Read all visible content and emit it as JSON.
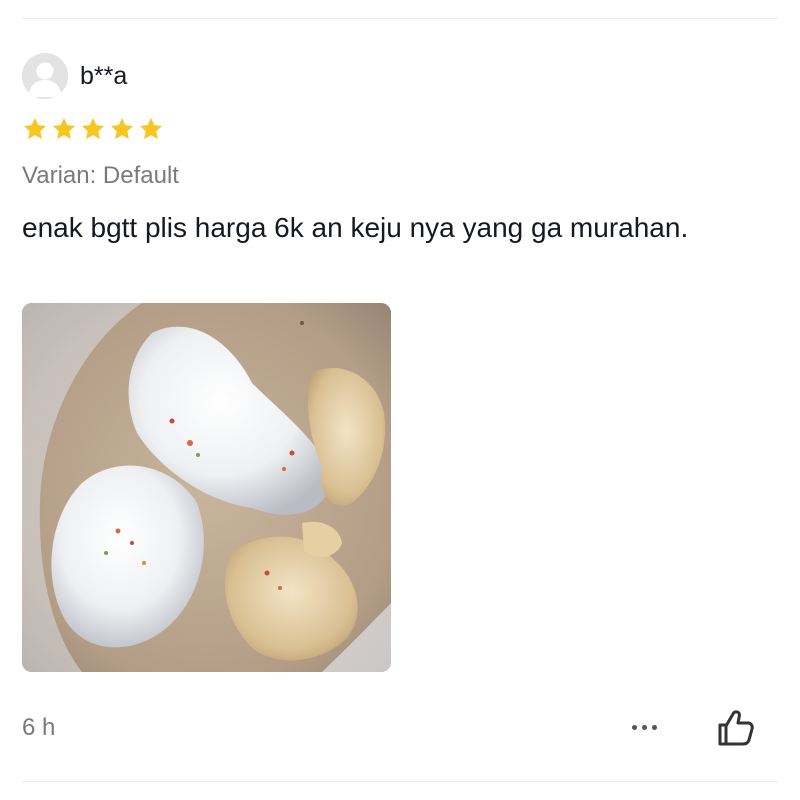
{
  "review": {
    "username": "b**a",
    "rating": 5,
    "rating_max": 5,
    "variant": "Varian: Default",
    "text": "enak bgtt plis harga 6k an keju nya yang ga murahan.",
    "timestamp": "6 h"
  },
  "icons": {
    "avatar": "default-user-avatar",
    "star": "star-filled-icon",
    "more": "more-horizontal-icon",
    "like": "thumbs-up-icon"
  },
  "colors": {
    "star": "#f7c524",
    "text": "#161823",
    "muted": "#7a7a7a"
  }
}
